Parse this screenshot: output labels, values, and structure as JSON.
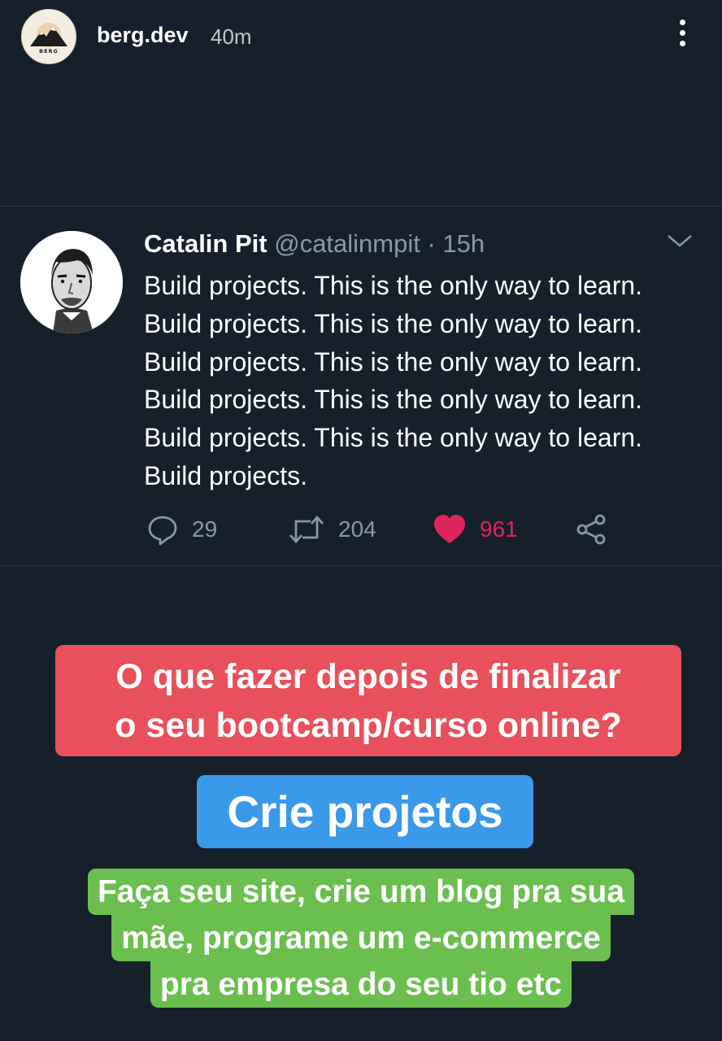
{
  "story": {
    "username": "berg.dev",
    "time": "40m",
    "avatar_logo_text": "BERG"
  },
  "tweet": {
    "name": "Catalin Pit",
    "handle": "@catalinmpit · 15h",
    "lines": [
      "Build projects. This is the only way to learn.",
      "Build projects. This is the only way to learn.",
      "Build projects. This is the only way to learn.",
      "Build projects. This is the only way to learn.",
      "Build projects. This is the only way to learn.",
      "Build projects."
    ],
    "replies": "29",
    "retweets": "204",
    "likes": "961"
  },
  "captions": {
    "red_line1": "O que fazer depois de finalizar",
    "red_line2": "o seu bootcamp/curso online?",
    "blue": "Crie projetos",
    "green_line1": "Faça seu site, crie um blog pra sua",
    "green_line2": "mãe, programe um e-commerce",
    "green_line3": "pra empresa do seu tio etc"
  },
  "colors": {
    "background": "#15202b",
    "red_caption": "#e8505b",
    "blue_caption": "#3b99e9",
    "green_caption": "#6bbf4f",
    "like": "#e0245e",
    "muted": "#8899a6"
  },
  "icons": [
    "berg-logo-icon",
    "more-vertical-icon",
    "chevron-down-icon",
    "reply-icon",
    "retweet-icon",
    "heart-icon",
    "share-icon"
  ]
}
